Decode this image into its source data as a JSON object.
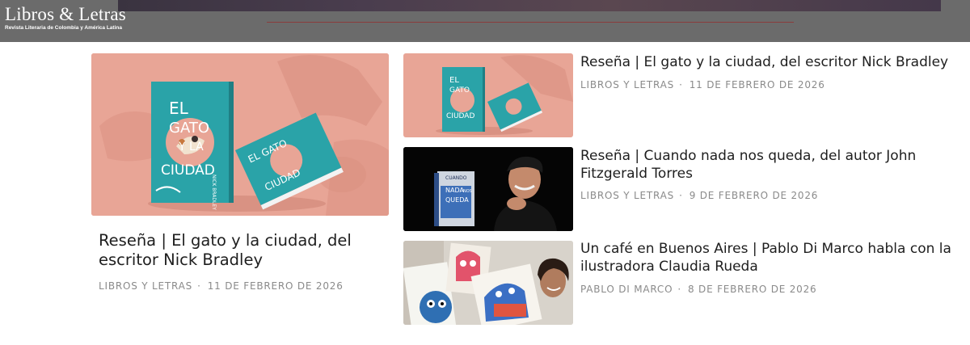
{
  "site": {
    "name": "Libros & Letras",
    "tagline": "Revista Literaria de Colombia y América Latina"
  },
  "featured": {
    "title": "Reseña | El gato y la ciudad, del escritor Nick Bradley",
    "author": "LIBROS Y LETRAS",
    "separator": "·",
    "date": "11 DE FEBRERO DE 2026",
    "book_cover": {
      "line1": "EL",
      "line2": "GATO",
      "line3": "Y LA",
      "line4": "CIUDAD",
      "author": "NICK BRADLEY"
    }
  },
  "articles": [
    {
      "title": "Reseña | El gato y la ciudad, del escritor Nick Bradley",
      "author": "LIBROS Y LETRAS",
      "separator": "·",
      "date": "11 DE FEBRERO DE 2026"
    },
    {
      "title": "Reseña | Cuando nada nos queda, del autor John Fitzgerald Torres",
      "author": "LIBROS Y LETRAS",
      "separator": "·",
      "date": "9 DE FEBRERO DE 2026",
      "book_cover": {
        "line1": "CUANDO",
        "line2": "NADA",
        "line3": "NOS",
        "line4": "QUEDA"
      }
    },
    {
      "title": "Un café en Buenos Aires | Pablo Di Marco habla con la ilustradora Claudia Rueda",
      "author": "PABLO DI MARCO",
      "separator": "·",
      "date": "8 DE FEBRERO DE 2026"
    }
  ],
  "colors": {
    "header_bg": "#6b6b6b",
    "peach": "#e8a596",
    "teal_cover": "#2aa3a8",
    "meta_text": "#8a8a8a"
  }
}
